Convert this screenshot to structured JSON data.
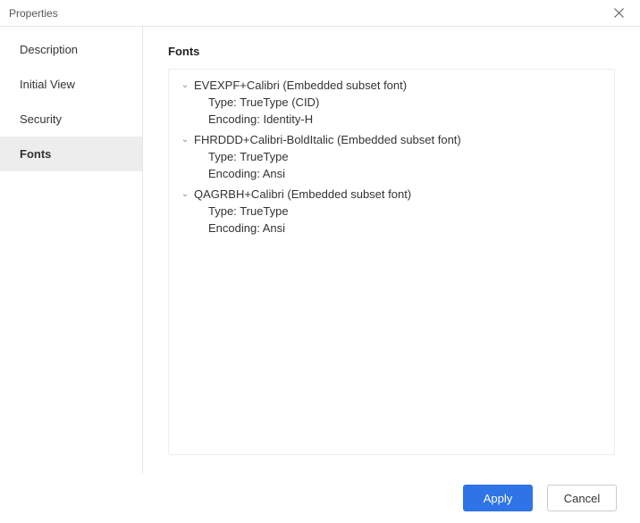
{
  "window": {
    "title": "Properties"
  },
  "sidebar": {
    "items": [
      {
        "label": "Description",
        "active": false
      },
      {
        "label": "Initial View",
        "active": false
      },
      {
        "label": "Security",
        "active": false
      },
      {
        "label": "Fonts",
        "active": true
      }
    ]
  },
  "main": {
    "section_title": "Fonts",
    "fonts": [
      {
        "name": "EVEXPF+Calibri (Embedded subset font)",
        "type_label": "Type:",
        "type_value": "TrueType (CID)",
        "encoding_label": "Encoding:",
        "encoding_value": "Identity-H"
      },
      {
        "name": "FHRDDD+Calibri-BoldItalic (Embedded subset font)",
        "type_label": "Type:",
        "type_value": "TrueType",
        "encoding_label": "Encoding:",
        "encoding_value": "Ansi"
      },
      {
        "name": "QAGRBH+Calibri (Embedded subset font)",
        "type_label": "Type:",
        "type_value": "TrueType",
        "encoding_label": "Encoding:",
        "encoding_value": "Ansi"
      }
    ]
  },
  "footer": {
    "apply_label": "Apply",
    "cancel_label": "Cancel"
  }
}
